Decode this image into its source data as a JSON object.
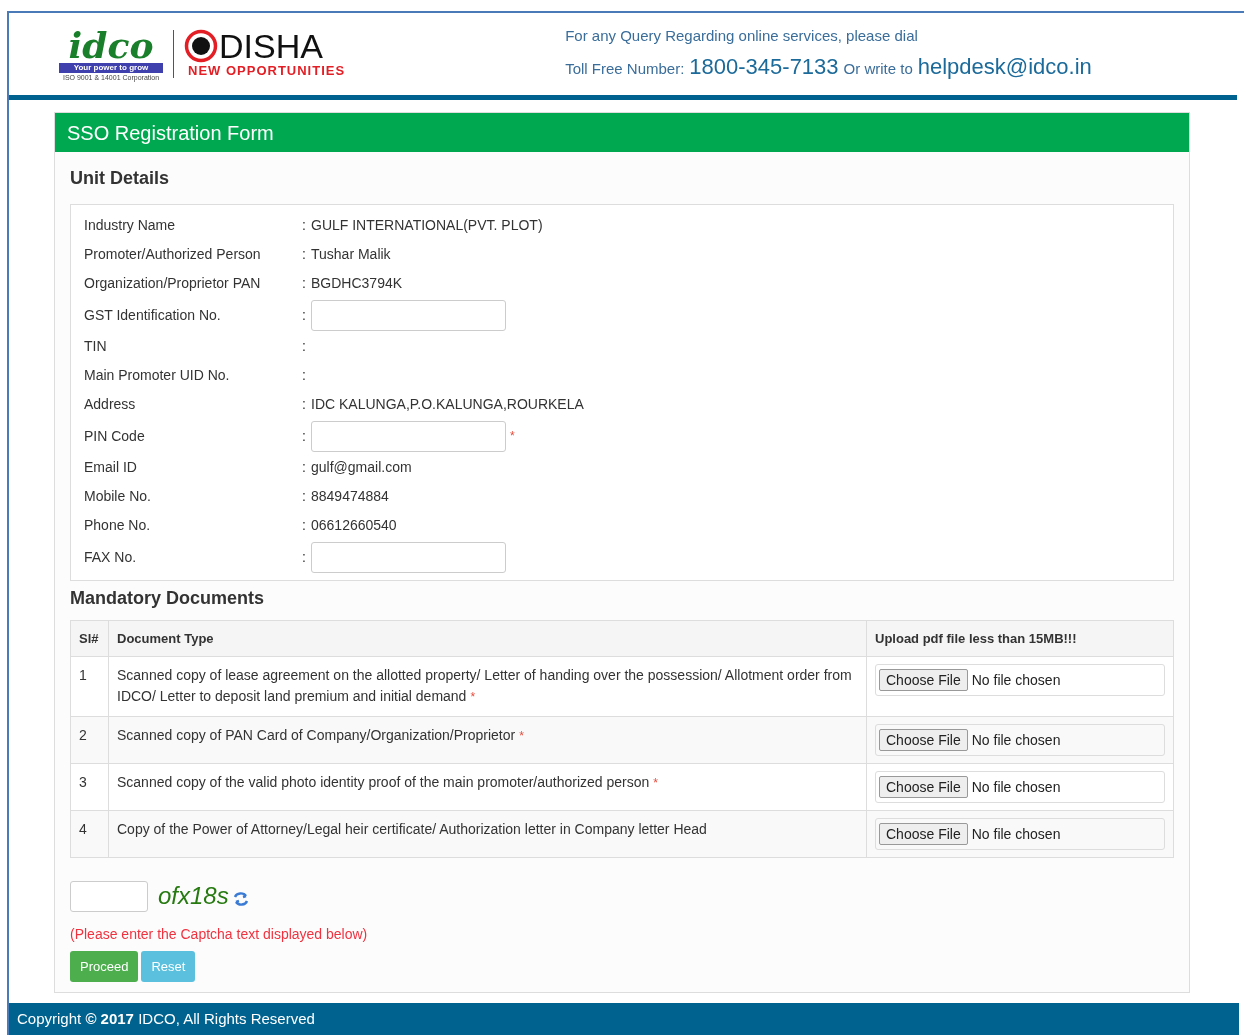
{
  "header": {
    "logo": {
      "name": "idco",
      "tagline": "Your power to grow",
      "certification": "ISO 9001 & 14001 Corporation",
      "brand": "DISHA",
      "brand_tagline": "NEW OPPORTUNITIES"
    },
    "query_text": "For any Query Regarding online services, please dial",
    "toll_free_label": "Toll Free Number:",
    "phone": "1800-345-7133",
    "or_write": "Or write to",
    "email": "helpdesk@idco.in"
  },
  "form": {
    "title": "SSO Registration Form",
    "unit_heading": "Unit Details",
    "fields": [
      {
        "label": "Industry Name",
        "kind": "text",
        "value": "GULF INTERNATIONAL(PVT. PLOT)"
      },
      {
        "label": "Promoter/Authorized Person",
        "kind": "text",
        "value": "Tushar Malik"
      },
      {
        "label": "Organization/Proprietor PAN",
        "kind": "text",
        "value": "BGDHC3794K"
      },
      {
        "label": "GST Identification No.",
        "kind": "input",
        "required": false
      },
      {
        "label": "TIN",
        "kind": "text"
      },
      {
        "label": "Main Promoter UID No.",
        "kind": "text"
      },
      {
        "label": "Address",
        "kind": "text",
        "value": "IDC KALUNGA,P.O.KALUNGA,ROURKELA"
      },
      {
        "label": "PIN Code",
        "kind": "input",
        "required": true
      },
      {
        "label": "Email ID",
        "kind": "text",
        "value": "gulf@gmail.com"
      },
      {
        "label": "Mobile No.",
        "kind": "text",
        "value": "8849474884"
      },
      {
        "label": "Phone No.",
        "kind": "text",
        "value": "06612660540"
      },
      {
        "label": "FAX No.",
        "kind": "input",
        "required": false
      }
    ],
    "separator": ":",
    "documents_heading": "Mandatory Documents",
    "documents": {
      "columns": [
        "Sl#",
        "Document Type",
        "Upload pdf file less than 15MB!!!"
      ],
      "rows": [
        {
          "sl": "1",
          "type": "Scanned copy of lease agreement on the allotted property/ Letter of handing over the possession/ Allotment order from IDCO/ Letter to deposit land premium and initial demand",
          "required": true,
          "button": "Choose File",
          "status": "No file chosen"
        },
        {
          "sl": "2",
          "type": "Scanned copy of PAN Card of Company/Organization/Proprietor",
          "required": true,
          "button": "Choose File",
          "status": "No file chosen"
        },
        {
          "sl": "3",
          "type": "Scanned copy of the valid photo identity proof of the main promoter/authorized person",
          "required": true,
          "button": "Choose File",
          "status": "No file chosen"
        },
        {
          "sl": "4",
          "type": "Copy of the Power of Attorney/Legal heir certificate/ Authorization letter in Company letter Head",
          "required": false,
          "button": "Choose File",
          "status": "No file chosen"
        }
      ]
    },
    "required_mark": "*",
    "captcha": {
      "code": "ofx18s",
      "hint": "(Please enter the Captcha text displayed below)"
    },
    "buttons": [
      {
        "label": "Proceed",
        "kind": "primary"
      },
      {
        "label": "Reset",
        "kind": "secondary"
      }
    ]
  },
  "footer": {
    "text": "Copyright **© 2017** IDCO, All Rights Reserved"
  }
}
